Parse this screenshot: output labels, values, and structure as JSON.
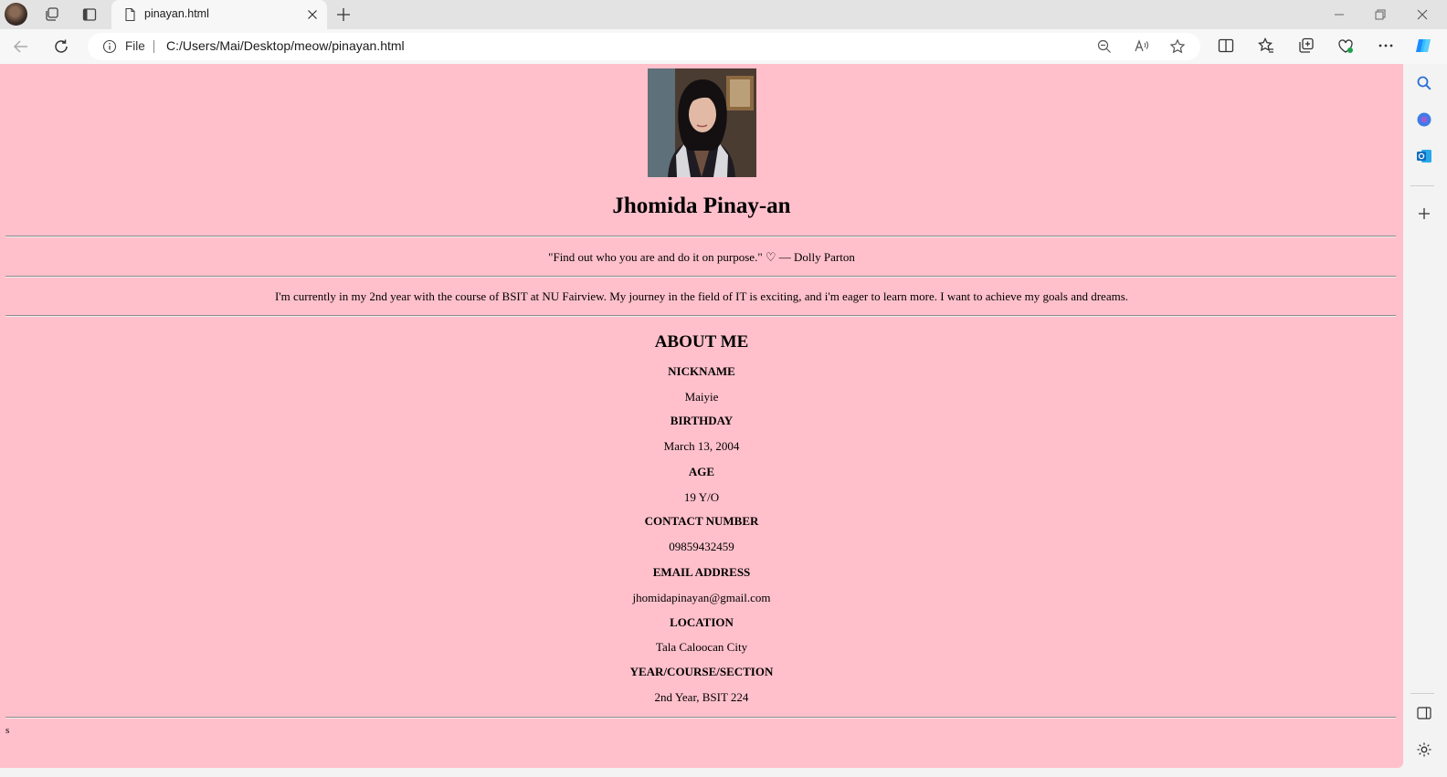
{
  "browser": {
    "tab_title": "pinayan.html",
    "address_scheme_label": "File",
    "address_url": "C:/Users/Mai/Desktop/meow/pinayan.html",
    "page_background": "#ffc0cb"
  },
  "profile": {
    "name": "Jhomida Pinay-an",
    "quote": "\"Find out who you are and do it on purpose.\" ♡ — Dolly Parton",
    "intro": "I'm currently in my 2nd year with the course of BSIT at NU Fairview. My journey in the field of IT is exciting, and i'm eager to learn more. I want to achieve my goals and dreams.",
    "about_heading": "ABOUT ME",
    "fields": [
      {
        "label": "NICKNAME",
        "value": "Maiyie"
      },
      {
        "label": "BIRTHDAY",
        "value": "March 13, 2004"
      },
      {
        "label": "AGE",
        "value": "19 Y/O"
      },
      {
        "label": "CONTACT NUMBER",
        "value": "09859432459"
      },
      {
        "label": "EMAIL ADDRESS",
        "value": "jhomidapinayan@gmail.com"
      },
      {
        "label": "LOCATION",
        "value": "Tala Caloocan City"
      },
      {
        "label": "YEAR/COURSE/SECTION",
        "value": "2nd Year, BSIT 224"
      }
    ],
    "footer_text": "s"
  }
}
